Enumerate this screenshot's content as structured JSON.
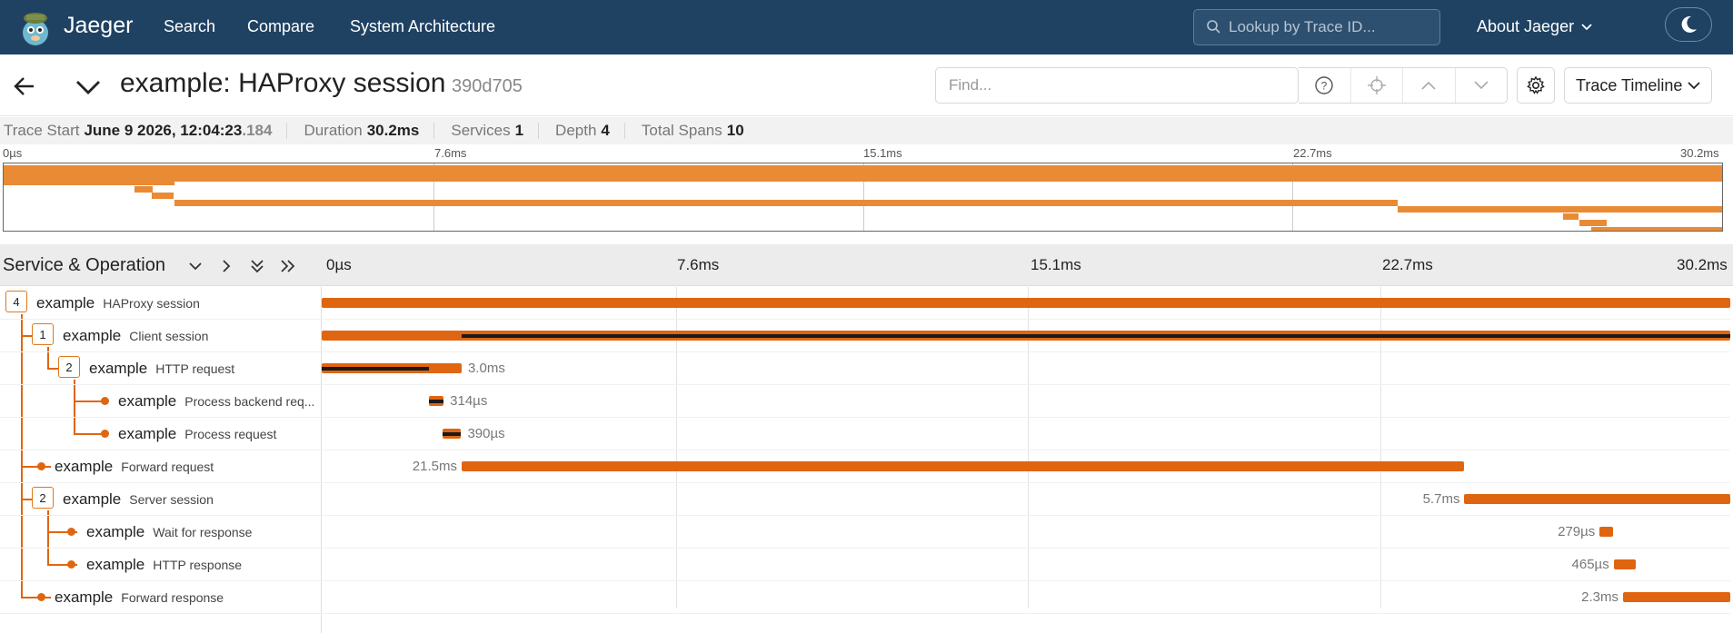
{
  "nav": {
    "brand": "Jaeger",
    "links": [
      "Search",
      "Compare",
      "System Architecture"
    ],
    "lookup_placeholder": "Lookup by Trace ID...",
    "about": "About Jaeger"
  },
  "trace": {
    "title": "example: HAProxy session",
    "id": "390d705",
    "find_placeholder": "Find...",
    "view": "Trace Timeline"
  },
  "summary": {
    "start_label": "Trace Start",
    "start_value": "June 9 2026, 12:04:23",
    "start_ms": ".184",
    "duration_label": "Duration",
    "duration_value": "30.2ms",
    "services_label": "Services",
    "services_value": "1",
    "depth_label": "Depth",
    "depth_value": "4",
    "spans_label": "Total Spans",
    "spans_value": "10"
  },
  "ticks": [
    "0µs",
    "7.6ms",
    "15.1ms",
    "22.7ms",
    "30.2ms"
  ],
  "timeline_header": "Service & Operation",
  "colors": {
    "nav_bg": "#1f4263",
    "span": "#e06510",
    "minimap_span": "#e98a35"
  },
  "spans": [
    {
      "service": "example",
      "operation": "HAProxy session",
      "depth": 0,
      "children": "4",
      "start_ms": 0,
      "dur_ms": 30.2,
      "dur_label": ""
    },
    {
      "service": "example",
      "operation": "Client session",
      "depth": 1,
      "children": "1",
      "start_ms": 0,
      "dur_ms": 30.2,
      "dur_label": ""
    },
    {
      "service": "example",
      "operation": "HTTP request",
      "depth": 2,
      "children": "2",
      "start_ms": 0,
      "dur_ms": 3.0,
      "dur_label": "3.0ms"
    },
    {
      "service": "example",
      "operation": "Process backend req...",
      "depth": 3,
      "children": "",
      "start_ms": 2.3,
      "dur_ms": 0.314,
      "dur_label": "314µs"
    },
    {
      "service": "example",
      "operation": "Process request",
      "depth": 3,
      "children": "",
      "start_ms": 2.6,
      "dur_ms": 0.39,
      "dur_label": "390µs"
    },
    {
      "service": "example",
      "operation": "Forward request",
      "depth": 1,
      "children": "",
      "start_ms": 3.0,
      "dur_ms": 21.5,
      "dur_label": "21.5ms"
    },
    {
      "service": "example",
      "operation": "Server session",
      "depth": 1,
      "children": "2",
      "start_ms": 24.5,
      "dur_ms": 5.7,
      "dur_label": "5.7ms"
    },
    {
      "service": "example",
      "operation": "Wait for response",
      "depth": 2,
      "children": "",
      "start_ms": 27.4,
      "dur_ms": 0.279,
      "dur_label": "279µs"
    },
    {
      "service": "example",
      "operation": "HTTP response",
      "depth": 2,
      "children": "",
      "start_ms": 27.7,
      "dur_ms": 0.465,
      "dur_label": "465µs"
    },
    {
      "service": "example",
      "operation": "Forward response",
      "depth": 1,
      "children": "",
      "start_ms": 27.9,
      "dur_ms": 2.3,
      "dur_label": "2.3ms"
    }
  ]
}
